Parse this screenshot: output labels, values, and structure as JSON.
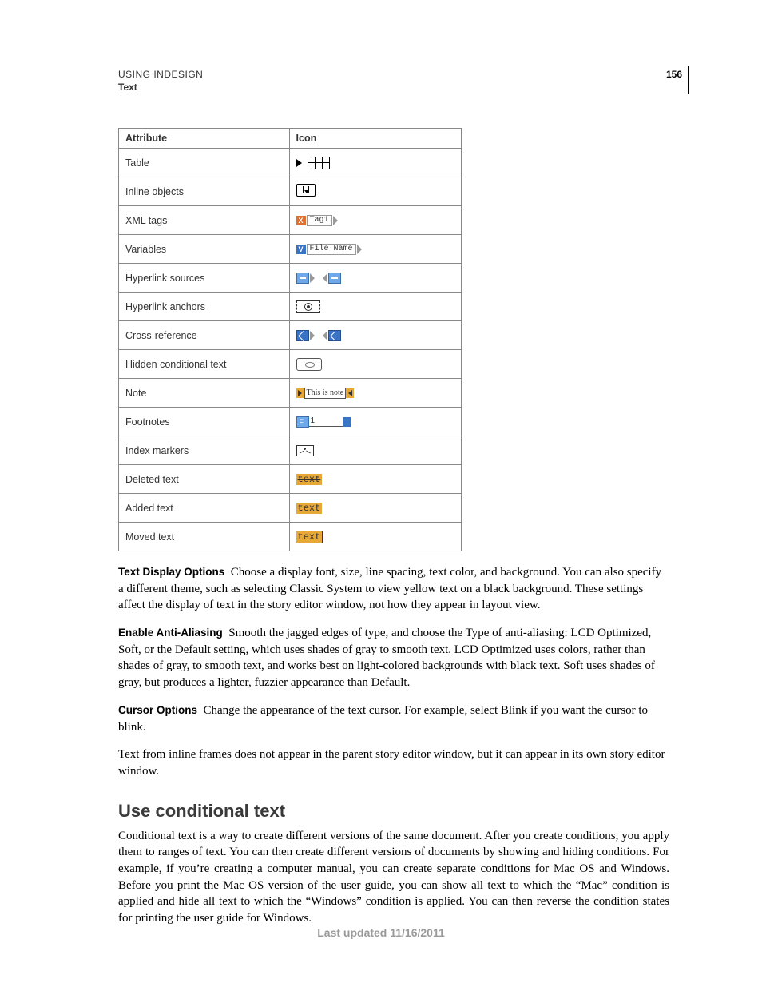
{
  "header": {
    "product": "USING INDESIGN",
    "chapter": "Text",
    "page_number": "156"
  },
  "table": {
    "col_attr": "Attribute",
    "col_icon": "Icon",
    "rows": [
      {
        "attr": "Table"
      },
      {
        "attr": "Inline objects"
      },
      {
        "attr": "XML tags",
        "chip": "Tag1"
      },
      {
        "attr": "Variables",
        "chip": "File Name"
      },
      {
        "attr": "Hyperlink sources"
      },
      {
        "attr": "Hyperlink anchors"
      },
      {
        "attr": "Cross-reference"
      },
      {
        "attr": "Hidden conditional text"
      },
      {
        "attr": "Note",
        "chip": "This is note"
      },
      {
        "attr": "Footnotes",
        "chip": "1"
      },
      {
        "attr": "Index markers"
      },
      {
        "attr": "Deleted text",
        "chip": "text"
      },
      {
        "attr": "Added text",
        "chip": "text"
      },
      {
        "attr": "Moved text",
        "chip": "text"
      }
    ]
  },
  "para": {
    "text_display": {
      "term": "Text Display Options",
      "body": "Choose a display font, size, line spacing, text color, and background. You can also specify a different theme, such as selecting Classic System to view yellow text on a black background. These settings affect the display of text in the story editor window, not how they appear in layout view."
    },
    "anti_aliasing": {
      "term": "Enable Anti-Aliasing",
      "body": "Smooth the jagged edges of type, and choose the Type of anti-aliasing: LCD Optimized, Soft, or the Default setting, which uses shades of gray to smooth text. LCD Optimized uses colors, rather than shades of gray, to smooth text, and works best on light-colored backgrounds with black text. Soft uses shades of gray, but produces a lighter, fuzzier appearance than Default."
    },
    "cursor": {
      "term": "Cursor Options",
      "body": "Change the appearance of the text cursor. For example, select Blink if you want the cursor to blink."
    },
    "inline_frames": "Text from inline frames does not appear in the parent story editor window, but it can appear in its own story editor window."
  },
  "section_heading": "Use conditional text",
  "section_body": "Conditional text is a way to create different versions of the same document. After you create conditions, you apply them to ranges of text. You can then create different versions of documents by showing and hiding conditions. For example, if you’re creating a computer manual, you can create separate conditions for Mac OS and Windows. Before you print the Mac OS version of the user guide, you can show all text to which the “Mac” condition is applied and hide all text to which the “Windows” condition is applied. You can then reverse the condition states for printing the user guide for Windows.",
  "footer": "Last updated 11/16/2011"
}
